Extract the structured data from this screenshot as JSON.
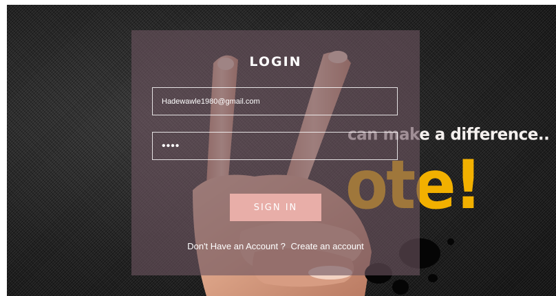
{
  "background": {
    "slogan": "can make a difference..",
    "vote_letters": "ote!",
    "accent_color": "#f2b000"
  },
  "login": {
    "title": "LOGIN",
    "email_value": "Hadewawle1980@gmail.com",
    "password_value": "••••",
    "sign_in_label": "SIGN IN",
    "no_account_text": "Don't Have an Account ?",
    "create_account_link": "Create an account",
    "button_color": "#e8aea8"
  }
}
